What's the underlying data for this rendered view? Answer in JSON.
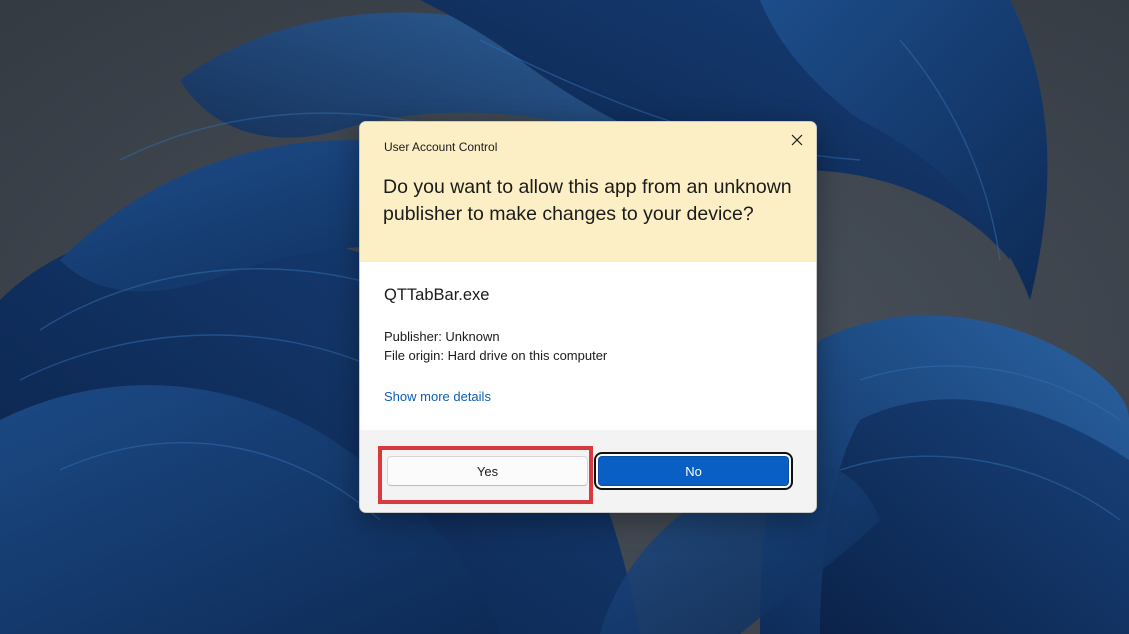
{
  "dialog": {
    "title": "User Account Control",
    "question": "Do you want to allow this app from an unknown publisher to make changes to your device?",
    "close_icon": "close-icon",
    "header_color": "#fcefc5"
  },
  "app": {
    "name": "QTTabBar.exe",
    "publisher": "Publisher: Unknown",
    "origin": "File origin: Hard drive on this computer",
    "details_link": "Show more details"
  },
  "buttons": {
    "yes_label": "Yes",
    "no_label": "No",
    "no_color": "#0a5fc4"
  },
  "annotation": {
    "highlight_color": "#d93a3e",
    "highlight_target": "yes-button"
  }
}
